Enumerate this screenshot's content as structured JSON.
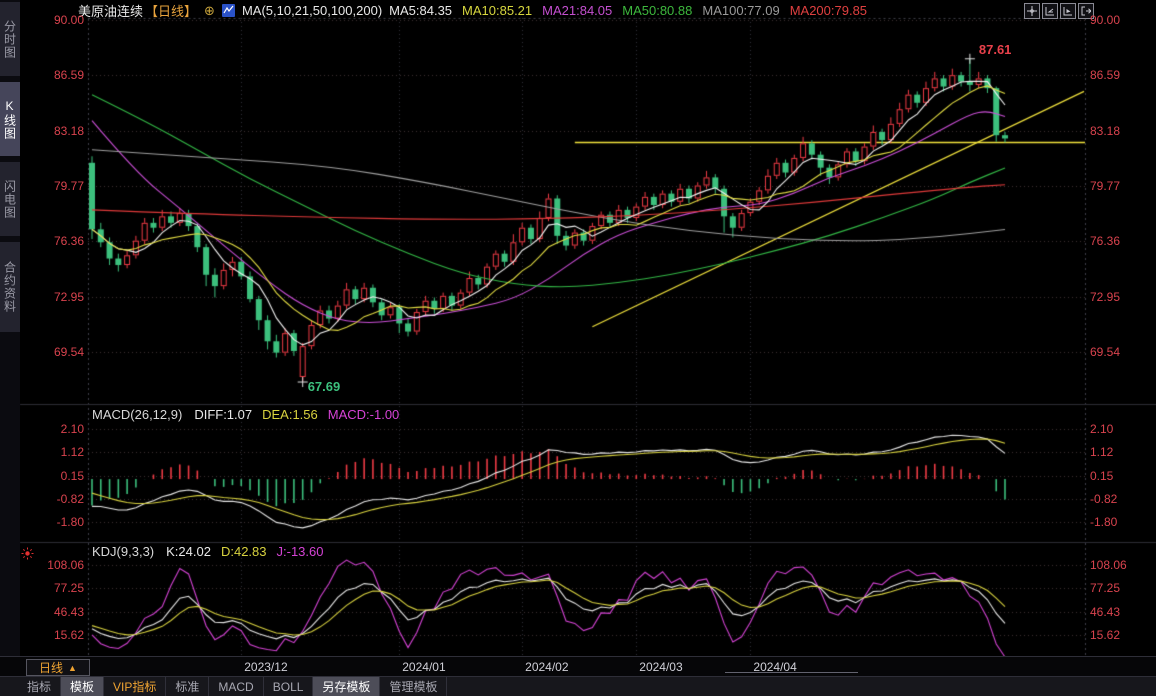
{
  "window_title": "美原油连续 日线 K线图",
  "colors": {
    "up": "#ef3b45",
    "down": "#3cc07d",
    "axis_text": "#d9434e",
    "date_text": "#d0d0d8",
    "ma5": "#f2f2f2",
    "ma10": "#e2dc43",
    "ma21": "#cb4fd7",
    "ma50": "#33b846",
    "ma100": "#a0a0a0",
    "ma200": "#e03a3a",
    "diff": "#e8e8e8",
    "dea": "#d8d23f",
    "macd_bar_neg": "#3cc07d",
    "macd_bar_pos": "#ef3b45",
    "k_line": "#e8e8e8",
    "d_line": "#d8d23f",
    "j_line": "#d543d5",
    "trend": "#f0e13c",
    "accent_orange": "#f0a432"
  },
  "sidebar": {
    "items": [
      {
        "label": "分时图",
        "name": "sidebar-item-timeshare",
        "active": false
      },
      {
        "label": "K线图",
        "name": "sidebar-item-kline",
        "active": true
      },
      {
        "label": "闪电图",
        "name": "sidebar-item-lightning",
        "active": false
      },
      {
        "label": "合约资料",
        "name": "sidebar-item-contract-info",
        "active": false
      }
    ]
  },
  "header": {
    "title": "美原油连续",
    "period_tag": "【日线】",
    "expand_symbol": "⊕",
    "ma_params": "MA(5,10,21,50,100,200)",
    "ma_values": [
      {
        "label": "MA5:84.35",
        "color": "#e8e8e8"
      },
      {
        "label": "MA10:85.21",
        "color": "#d6d63e"
      },
      {
        "label": "MA21:84.05",
        "color": "#c44fd0"
      },
      {
        "label": "MA50:80.88",
        "color": "#3db83d"
      },
      {
        "label": "MA100:77.09",
        "color": "#9a9a9a"
      },
      {
        "label": "MA200:79.85",
        "color": "#e04040"
      }
    ],
    "toolbar_icons": [
      "crosshair-tool",
      "shrink-time-axis",
      "expand-time-axis",
      "exit-chart"
    ]
  },
  "panes": {
    "macd": {
      "title": "MACD(26,12,9)",
      "values": [
        {
          "label": "DIFF:1.07",
          "color": "#e8e8e8"
        },
        {
          "label": "DEA:1.56",
          "color": "#d8d23f"
        },
        {
          "label": "MACD:-1.00",
          "color": "#d543d5"
        }
      ]
    },
    "kdj": {
      "title": "KDJ(9,3,3)",
      "values": [
        {
          "label": "K:24.02",
          "color": "#e8e8e8"
        },
        {
          "label": "D:42.83",
          "color": "#d8d23f"
        },
        {
          "label": "J:-13.60",
          "color": "#d543d5"
        }
      ]
    }
  },
  "period_selector": {
    "label": "日线",
    "arrow": "▲"
  },
  "bottom_tabs": [
    {
      "label": "指标",
      "style": "plain"
    },
    {
      "label": "模板",
      "style": "selected"
    },
    {
      "label": "VIP指标",
      "style": "vip"
    },
    {
      "label": "标准",
      "style": "plain"
    },
    {
      "label": "MACD",
      "style": "plain"
    },
    {
      "label": "BOLL",
      "style": "plain"
    },
    {
      "label": "另存模板",
      "style": "selected"
    },
    {
      "label": "管理模板",
      "style": "plain"
    }
  ],
  "chart_data": {
    "type": "candlestick",
    "title": "美原油连续 日线",
    "legend_position": "top",
    "grid": true,
    "price_ticks": [
      90.0,
      86.59,
      83.18,
      79.77,
      76.36,
      72.95,
      69.54
    ],
    "macd_ticks": [
      2.1,
      1.12,
      0.15,
      -0.82,
      -1.8
    ],
    "kdj_ticks": [
      108.06,
      77.25,
      46.43,
      15.62
    ],
    "x_ticks": [
      {
        "label": "2023/12",
        "index": 17
      },
      {
        "label": "2024/01",
        "index": 35
      },
      {
        "label": "2024/02",
        "index": 49
      },
      {
        "label": "2024/03",
        "index": 62
      },
      {
        "label": "2024/04",
        "index": 75
      }
    ],
    "candles": [
      [
        81.2,
        81.6,
        76.5,
        77.1
      ],
      [
        77.1,
        77.5,
        76.0,
        76.3
      ],
      [
        76.3,
        76.6,
        74.9,
        75.3
      ],
      [
        75.3,
        75.6,
        74.5,
        74.9
      ],
      [
        74.9,
        75.8,
        74.7,
        75.5
      ],
      [
        75.5,
        76.7,
        75.3,
        76.4
      ],
      [
        76.4,
        77.8,
        76.2,
        77.5
      ],
      [
        77.5,
        77.8,
        76.9,
        77.2
      ],
      [
        77.2,
        78.3,
        77.0,
        77.9
      ],
      [
        77.9,
        78.2,
        77.2,
        77.5
      ],
      [
        77.5,
        78.4,
        77.3,
        78.1
      ],
      [
        78.1,
        78.3,
        77.0,
        77.3
      ],
      [
        77.3,
        77.5,
        75.7,
        76.0
      ],
      [
        76.0,
        76.2,
        73.6,
        74.3
      ],
      [
        74.3,
        74.7,
        72.9,
        73.6
      ],
      [
        73.6,
        75.0,
        73.4,
        74.6
      ],
      [
        74.6,
        75.4,
        74.2,
        75.1
      ],
      [
        75.1,
        75.4,
        74.0,
        74.2
      ],
      [
        74.2,
        74.5,
        72.6,
        72.8
      ],
      [
        72.8,
        73.0,
        70.9,
        71.5
      ],
      [
        71.5,
        71.8,
        69.7,
        70.2
      ],
      [
        70.2,
        70.6,
        69.2,
        69.5
      ],
      [
        69.5,
        71.0,
        69.3,
        70.7
      ],
      [
        70.7,
        70.9,
        69.3,
        69.6
      ],
      [
        68.0,
        70.1,
        67.69,
        69.9
      ],
      [
        69.9,
        71.5,
        69.7,
        71.2
      ],
      [
        71.2,
        72.4,
        71.0,
        72.1
      ],
      [
        72.1,
        72.4,
        71.3,
        71.6
      ],
      [
        71.6,
        72.7,
        71.4,
        72.4
      ],
      [
        72.4,
        73.8,
        72.2,
        73.4
      ],
      [
        73.4,
        73.6,
        72.5,
        72.8
      ],
      [
        72.8,
        73.8,
        72.6,
        73.5
      ],
      [
        73.5,
        73.7,
        72.3,
        72.6
      ],
      [
        72.6,
        72.8,
        71.5,
        71.8
      ],
      [
        71.8,
        72.6,
        71.6,
        72.3
      ],
      [
        72.3,
        72.5,
        70.7,
        71.3
      ],
      [
        71.3,
        71.6,
        70.5,
        70.8
      ],
      [
        70.8,
        72.2,
        70.6,
        72.0
      ],
      [
        72.0,
        73.0,
        71.8,
        72.7
      ],
      [
        72.7,
        72.9,
        71.9,
        72.2
      ],
      [
        72.2,
        73.2,
        72.0,
        73.0
      ],
      [
        73.0,
        73.2,
        72.1,
        72.4
      ],
      [
        72.4,
        73.4,
        72.2,
        73.2
      ],
      [
        73.2,
        74.5,
        73.0,
        74.1
      ],
      [
        74.1,
        74.3,
        73.4,
        73.7
      ],
      [
        73.7,
        75.0,
        73.5,
        74.8
      ],
      [
        74.8,
        75.8,
        74.6,
        75.6
      ],
      [
        75.6,
        75.8,
        74.8,
        75.1
      ],
      [
        75.1,
        76.8,
        74.9,
        76.3
      ],
      [
        76.3,
        77.5,
        76.1,
        77.2
      ],
      [
        77.2,
        77.4,
        76.2,
        76.5
      ],
      [
        76.5,
        78.2,
        76.3,
        77.8
      ],
      [
        77.8,
        79.3,
        77.6,
        79.0
      ],
      [
        79.0,
        79.2,
        76.2,
        76.7
      ],
      [
        76.7,
        77.0,
        75.8,
        76.1
      ],
      [
        76.1,
        77.1,
        75.9,
        76.9
      ],
      [
        76.9,
        77.1,
        76.1,
        76.4
      ],
      [
        76.4,
        77.5,
        76.2,
        77.3
      ],
      [
        77.3,
        78.2,
        77.1,
        78.0
      ],
      [
        78.0,
        78.2,
        77.2,
        77.5
      ],
      [
        77.5,
        78.6,
        77.3,
        78.3
      ],
      [
        78.3,
        78.5,
        77.5,
        77.8
      ],
      [
        77.8,
        78.7,
        77.6,
        78.5
      ],
      [
        78.5,
        79.4,
        78.3,
        79.1
      ],
      [
        79.1,
        79.3,
        78.3,
        78.6
      ],
      [
        78.6,
        79.5,
        78.4,
        79.3
      ],
      [
        79.3,
        79.5,
        78.5,
        78.8
      ],
      [
        78.8,
        79.9,
        78.6,
        79.6
      ],
      [
        79.6,
        79.8,
        78.7,
        79.0
      ],
      [
        79.0,
        80.0,
        78.8,
        79.8
      ],
      [
        79.8,
        80.7,
        79.6,
        80.3
      ],
      [
        80.3,
        80.5,
        79.3,
        79.6
      ],
      [
        79.6,
        79.8,
        76.9,
        77.9
      ],
      [
        77.9,
        78.1,
        76.6,
        77.2
      ],
      [
        77.2,
        78.3,
        77.0,
        78.1
      ],
      [
        78.1,
        79.0,
        77.9,
        78.8
      ],
      [
        78.8,
        79.7,
        78.6,
        79.5
      ],
      [
        79.5,
        80.8,
        79.3,
        80.4
      ],
      [
        80.4,
        81.5,
        80.2,
        81.2
      ],
      [
        81.2,
        81.4,
        80.3,
        80.6
      ],
      [
        80.6,
        81.7,
        80.4,
        81.5
      ],
      [
        81.5,
        82.8,
        81.3,
        82.4
      ],
      [
        82.4,
        82.6,
        81.4,
        81.7
      ],
      [
        81.7,
        81.9,
        80.4,
        80.9
      ],
      [
        80.9,
        81.1,
        79.9,
        80.3
      ],
      [
        80.3,
        81.3,
        80.1,
        81.1
      ],
      [
        81.1,
        82.1,
        80.9,
        81.9
      ],
      [
        81.9,
        82.1,
        81.0,
        81.3
      ],
      [
        81.3,
        82.4,
        81.1,
        82.2
      ],
      [
        82.2,
        83.5,
        82.0,
        83.1
      ],
      [
        83.1,
        83.3,
        82.3,
        82.6
      ],
      [
        82.6,
        84.0,
        82.4,
        83.6
      ],
      [
        83.6,
        84.9,
        83.4,
        84.5
      ],
      [
        84.5,
        85.7,
        84.3,
        85.4
      ],
      [
        85.4,
        85.6,
        84.6,
        84.9
      ],
      [
        84.9,
        86.2,
        84.7,
        85.8
      ],
      [
        85.8,
        86.8,
        85.6,
        86.4
      ],
      [
        86.4,
        86.6,
        85.6,
        85.9
      ],
      [
        85.9,
        87.0,
        85.7,
        86.6
      ],
      [
        86.6,
        86.8,
        85.9,
        86.2
      ],
      [
        86.2,
        87.61,
        85.6,
        86.0
      ],
      [
        86.0,
        86.8,
        85.8,
        86.4
      ],
      [
        86.4,
        86.6,
        85.5,
        85.8
      ],
      [
        85.8,
        85.9,
        82.5,
        82.9
      ],
      [
        82.9,
        83.1,
        82.45,
        82.7
      ]
    ],
    "ma_computed": [
      {
        "name": "MA5",
        "window": 5,
        "color": "#f2f2f2"
      },
      {
        "name": "MA10",
        "window": 10,
        "color": "#e2dc43"
      }
    ],
    "ma_paths": [
      {
        "name": "MA21",
        "color": "#cb4fd7",
        "points": [
          [
            0,
            83.8
          ],
          [
            5,
            80.6
          ],
          [
            10,
            78.4
          ],
          [
            15,
            76.1
          ],
          [
            20,
            73.9
          ],
          [
            24,
            72.4
          ],
          [
            28,
            71.5
          ],
          [
            32,
            71.3
          ],
          [
            36,
            71.6
          ],
          [
            40,
            71.9
          ],
          [
            44,
            72.3
          ],
          [
            48,
            72.8
          ],
          [
            52,
            74.0
          ],
          [
            56,
            75.6
          ],
          [
            60,
            76.8
          ],
          [
            64,
            77.5
          ],
          [
            68,
            78.1
          ],
          [
            72,
            78.5
          ],
          [
            76,
            78.6
          ],
          [
            80,
            79.3
          ],
          [
            84,
            80.3
          ],
          [
            88,
            81.0
          ],
          [
            92,
            81.9
          ],
          [
            96,
            83.0
          ],
          [
            100,
            84.2
          ],
          [
            102,
            84.4
          ],
          [
            104,
            84.05
          ]
        ]
      },
      {
        "name": "MA50",
        "color": "#33b846",
        "points": [
          [
            0,
            85.4
          ],
          [
            6,
            83.8
          ],
          [
            12,
            82.0
          ],
          [
            18,
            80.2
          ],
          [
            24,
            78.6
          ],
          [
            30,
            77.0
          ],
          [
            36,
            75.6
          ],
          [
            42,
            74.4
          ],
          [
            48,
            73.7
          ],
          [
            54,
            73.5
          ],
          [
            60,
            73.8
          ],
          [
            66,
            74.3
          ],
          [
            72,
            75.0
          ],
          [
            78,
            75.8
          ],
          [
            84,
            76.7
          ],
          [
            90,
            77.8
          ],
          [
            96,
            79.0
          ],
          [
            100,
            80.0
          ],
          [
            104,
            80.88
          ]
        ]
      },
      {
        "name": "MA100",
        "color": "#a0a0a0",
        "points": [
          [
            0,
            82.0
          ],
          [
            14,
            81.5
          ],
          [
            27,
            81.0
          ],
          [
            38,
            80.0
          ],
          [
            48,
            78.9
          ],
          [
            58,
            77.8
          ],
          [
            68,
            77.0
          ],
          [
            78,
            76.5
          ],
          [
            88,
            76.35
          ],
          [
            96,
            76.6
          ],
          [
            104,
            77.09
          ]
        ]
      },
      {
        "name": "MA200",
        "color": "#e03a3a",
        "points": [
          [
            0,
            78.3
          ],
          [
            12,
            78.05
          ],
          [
            25,
            77.85
          ],
          [
            40,
            77.7
          ],
          [
            52,
            77.75
          ],
          [
            62,
            77.95
          ],
          [
            72,
            78.3
          ],
          [
            82,
            78.75
          ],
          [
            92,
            79.3
          ],
          [
            100,
            79.7
          ],
          [
            104,
            79.85
          ]
        ]
      }
    ],
    "trendline": {
      "from": {
        "index": 57,
        "price": 71.1
      },
      "to": {
        "index": 113,
        "price": 85.6
      },
      "color": "#f0e13c"
    },
    "hline": {
      "price": 82.45,
      "from_index": 55,
      "color": "#f0e13c"
    },
    "annotations": {
      "high": {
        "index": 100,
        "price": 87.61,
        "label": "87.61",
        "color": "#e8414b"
      },
      "low": {
        "index": 24,
        "price": 67.69,
        "label": "67.69",
        "color": "#3cc07d"
      }
    },
    "macd_params": "26,12,9",
    "macd_last": {
      "diff": 1.07,
      "dea": 1.56,
      "macd": -1.0
    },
    "kdj_params": "9,3,3",
    "kdj_last": {
      "k": 24.02,
      "d": 42.83,
      "j": -13.6
    }
  }
}
